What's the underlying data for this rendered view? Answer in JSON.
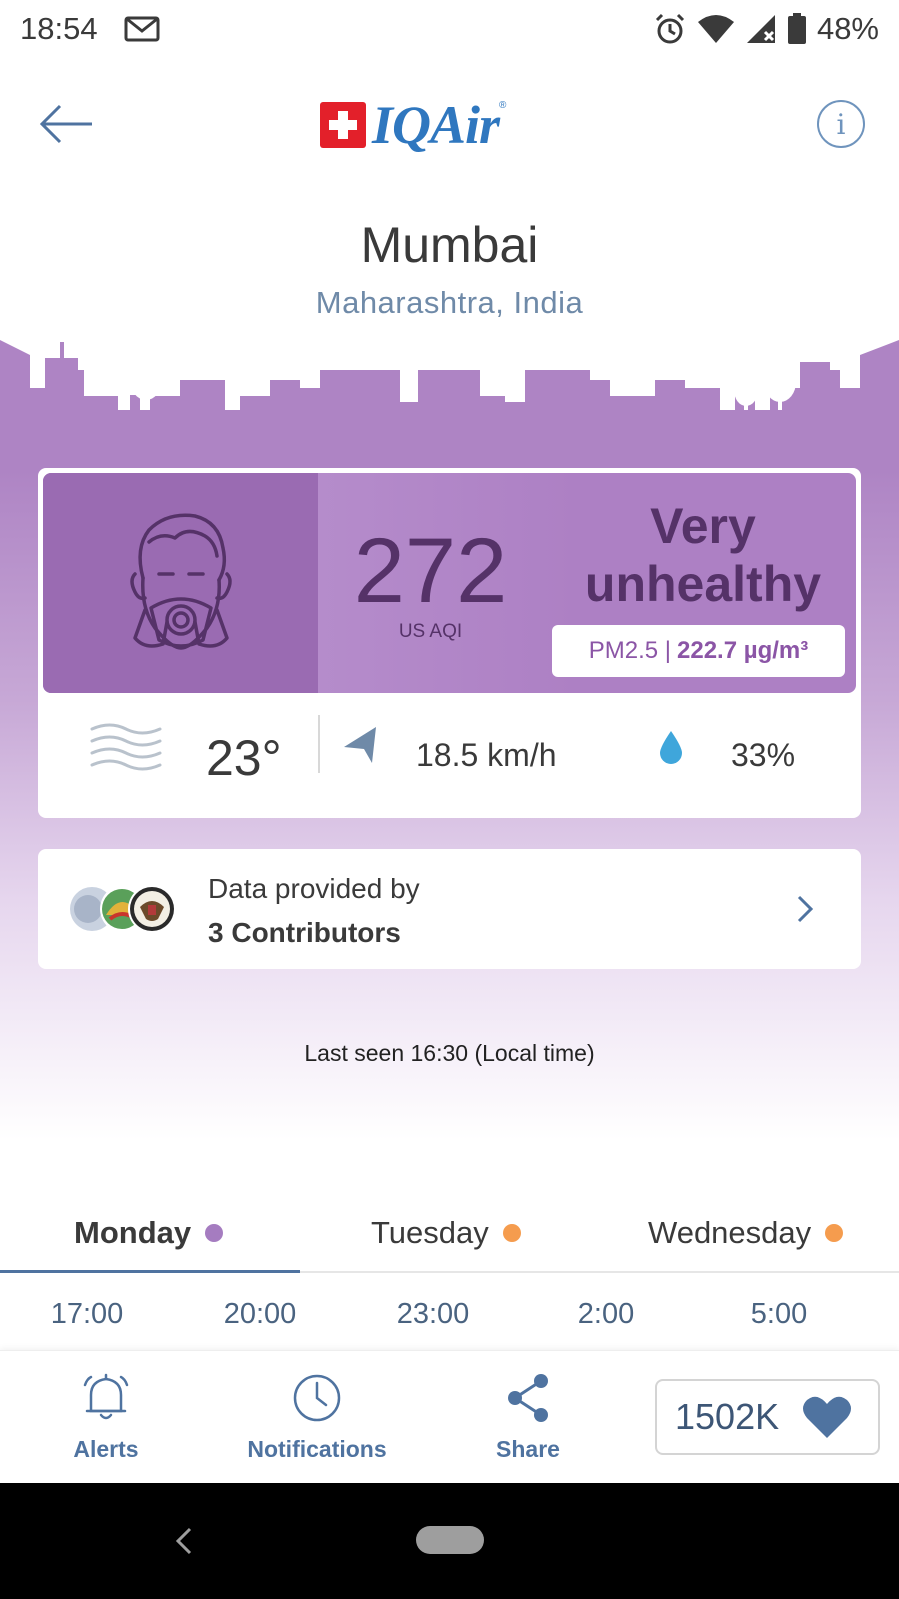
{
  "status_bar": {
    "time": "18:54",
    "battery": "48%",
    "icons": [
      "gmail-icon",
      "alarm-icon",
      "wifi-icon",
      "signal-icon",
      "battery-icon"
    ]
  },
  "header": {
    "logo_text": "IQAir",
    "logo_reg": "®",
    "info_label": "i"
  },
  "location": {
    "city": "Mumbai",
    "region": "Maharashtra, India"
  },
  "aqi": {
    "value": "272",
    "unit": "US AQI",
    "status": "Very unhealthy",
    "pollutant": "PM2.5 |",
    "concentration": "222.7 µg/m³",
    "colors": {
      "band": "#ad80c4",
      "face_box": "#9a6bb2",
      "text": "#553268"
    }
  },
  "weather": {
    "temperature": "23°",
    "wind": "18.5 km/h",
    "humidity": "33%"
  },
  "contributors": {
    "line1": "Data provided by",
    "line2": "3 Contributors"
  },
  "last_seen": "Last seen 16:30 (Local time)",
  "forecast": {
    "tabs": [
      {
        "label": "Monday",
        "dot": "#a57cc0",
        "active": true
      },
      {
        "label": "Tuesday",
        "dot": "#f59c4e",
        "active": false
      },
      {
        "label": "Wednesday",
        "dot": "#f59c4e",
        "active": false
      }
    ],
    "hours": [
      "17:00",
      "20:00",
      "23:00",
      "2:00",
      "5:00"
    ]
  },
  "bottom_nav": {
    "alerts": "Alerts",
    "notifications": "Notifications",
    "share": "Share",
    "followers": "1502K"
  },
  "accent_color": "#4f73a0"
}
